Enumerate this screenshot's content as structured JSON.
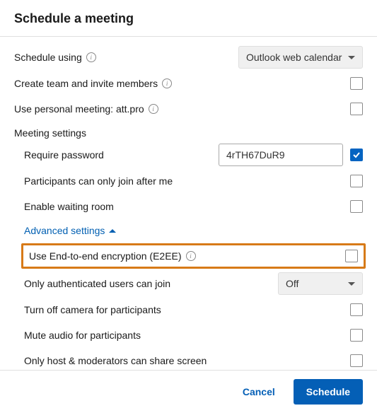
{
  "header": {
    "title": "Schedule a meeting"
  },
  "scheduleUsing": {
    "label": "Schedule using",
    "selected": "Outlook web calendar"
  },
  "createTeam": {
    "label": "Create team and invite members",
    "checked": false
  },
  "personalMeeting": {
    "label": "Use personal meeting: att.pro",
    "checked": false
  },
  "meetingSettings": {
    "title": "Meeting settings",
    "requirePassword": {
      "label": "Require password",
      "value": "4rTH67DuR9",
      "checked": true
    },
    "joinAfterMe": {
      "label": "Participants can only join after me",
      "checked": false
    },
    "waitingRoom": {
      "label": "Enable waiting room",
      "checked": false
    }
  },
  "advanced": {
    "toggleLabel": "Advanced settings",
    "e2ee": {
      "label": "Use End-to-end encryption (E2EE)",
      "checked": false
    },
    "authOnly": {
      "label": "Only authenticated users can join",
      "selected": "Off"
    },
    "turnOffCamera": {
      "label": "Turn off camera for participants",
      "checked": false
    },
    "muteAudio": {
      "label": "Mute audio for participants",
      "checked": false
    },
    "hostShare": {
      "label": "Only host & moderators can share screen",
      "checked": false
    }
  },
  "footer": {
    "cancel": "Cancel",
    "schedule": "Schedule"
  }
}
